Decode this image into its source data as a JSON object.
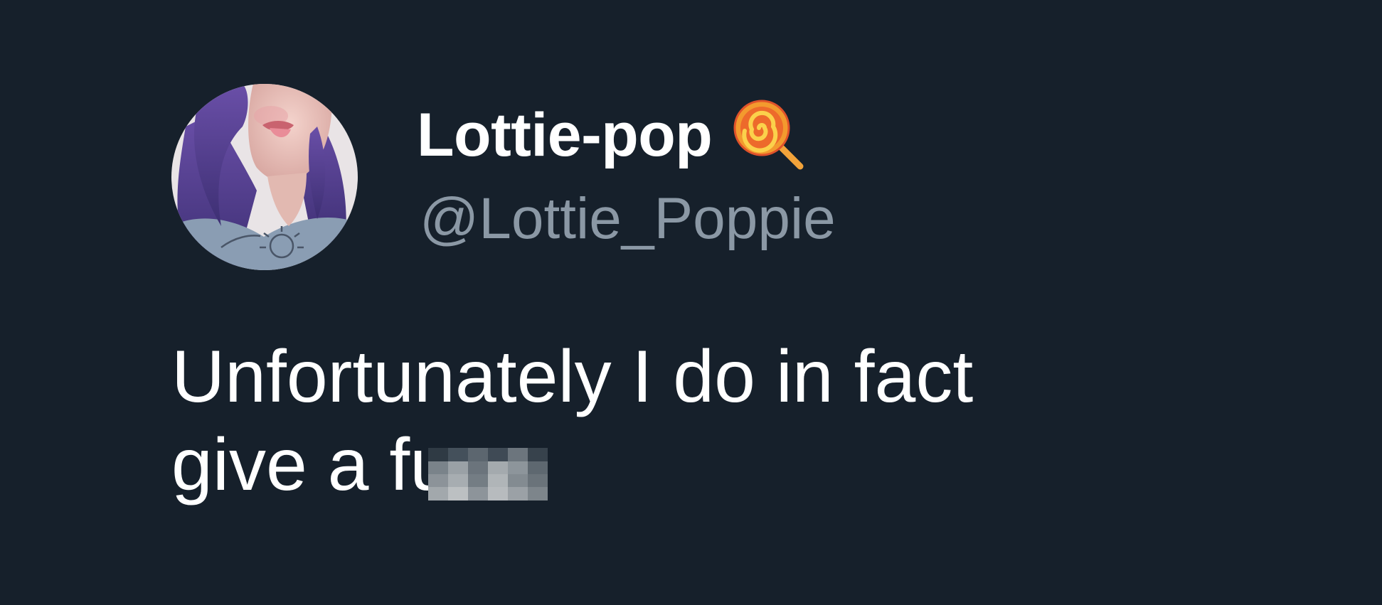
{
  "tweet": {
    "author": {
      "display_name": "Lottie-pop",
      "name_emoji_icon": "lollipop-icon",
      "handle": "@Lottie_Poppie",
      "avatar_icon": "profile-photo"
    },
    "text": {
      "line1": "Unfortunately I do in fact",
      "line2": "give a fu",
      "redacted_icon": "pixelated-censor-block"
    }
  },
  "colors": {
    "background": "#16202b",
    "display_name": "#ffffff",
    "handle": "#8b98a5",
    "text": "#ffffff"
  }
}
